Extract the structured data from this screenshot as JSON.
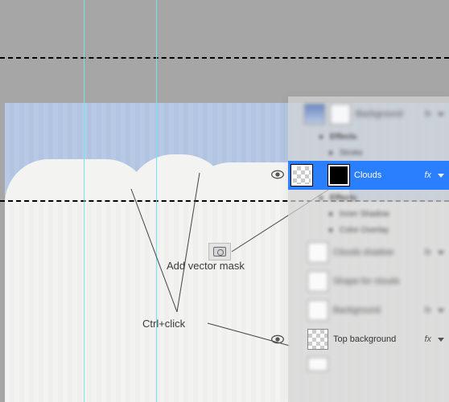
{
  "annotations": {
    "add_vector_mask": "Add vector mask",
    "ctrl_click": "Ctrl+click"
  },
  "layers_panel": {
    "header": {
      "name": "Background",
      "fx_label": "fx"
    },
    "effects_label": "Effects",
    "effect_stroke": "Stroke",
    "effect_color_overlay": "Color Overlay",
    "effect_inner_shadow": "Inner Shadow",
    "selected": {
      "name": "Clouds",
      "fx_label": "fx"
    },
    "rows": [
      {
        "name": "Clouds shadow",
        "fx_label": "fx"
      },
      {
        "name": "Shape for clouds",
        "fx_label": ""
      },
      {
        "name": "Background",
        "fx_label": "fx"
      },
      {
        "name": "Top background",
        "fx_label": "fx"
      }
    ]
  },
  "colors": {
    "selection": "#2a7fff",
    "sky": "#b7c9e4",
    "guide": "#6fe7f2"
  }
}
